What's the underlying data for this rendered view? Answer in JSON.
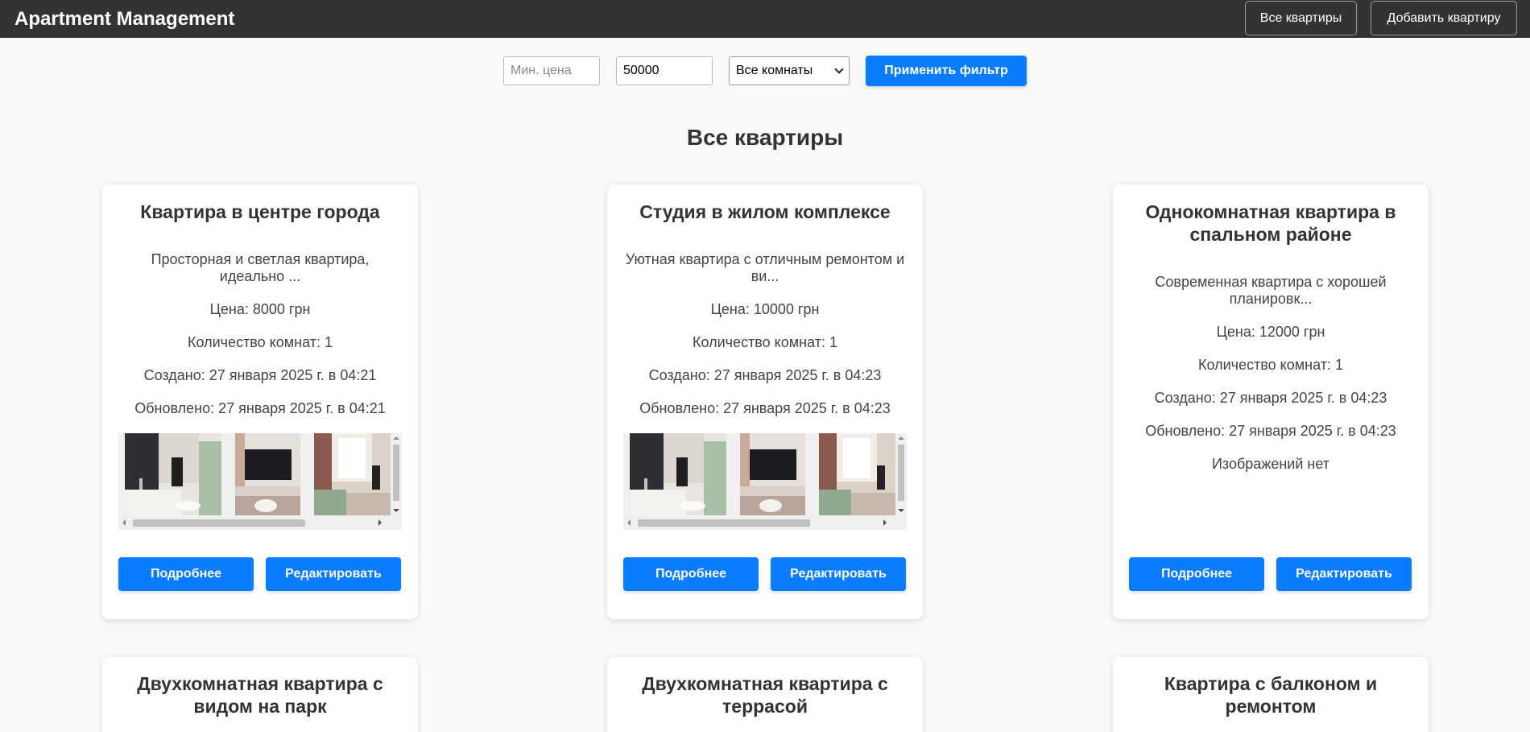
{
  "header": {
    "brand": "Apartment Management",
    "nav": {
      "all_label": "Все квартиры",
      "add_label": "Добавить квартиру"
    }
  },
  "filter": {
    "min_price_placeholder": "Мин. цена",
    "min_price_value": "",
    "max_price_value": "50000",
    "rooms_selected": "Все комнаты",
    "apply_label": "Применить фильтр"
  },
  "page_title": "Все квартиры",
  "cards": [
    {
      "title": "Квартира в центре города",
      "description": "Просторная и светлая квартира, идеально ...",
      "price": "Цена: 8000 грн",
      "rooms": "Количество комнат: 1",
      "created": "Создано: 27 января 2025 г. в 04:21",
      "updated": "Обновлено: 27 января 2025 г. в 04:21",
      "more_label": "Подробнее",
      "edit_label": "Редактировать"
    },
    {
      "title": "Студия в жилом комплексе",
      "description": "Уютная квартира с отличным ремонтом и ви...",
      "price": "Цена: 10000 грн",
      "rooms": "Количество комнат: 1",
      "created": "Создано: 27 января 2025 г. в 04:23",
      "updated": "Обновлено: 27 января 2025 г. в 04:23",
      "more_label": "Подробнее",
      "edit_label": "Редактировать"
    },
    {
      "title": "Однокомнатная квартира в спальном районе",
      "description": "Современная квартира с хорошей планировк...",
      "price": "Цена: 12000 грн",
      "rooms": "Количество комнат: 1",
      "created": "Создано: 27 января 2025 г. в 04:23",
      "updated": "Обновлено: 27 января 2025 г. в 04:23",
      "no_images": "Изображений нет",
      "more_label": "Подробнее",
      "edit_label": "Редактировать"
    },
    {
      "title": "Двухкомнатная квартира с видом на парк"
    },
    {
      "title": "Двухкомнатная квартира с террасой"
    },
    {
      "title": "Квартира с балконом и ремонтом"
    }
  ],
  "colors": {
    "primary": "#0a7cff",
    "header_bg": "#333333",
    "page_bg": "#f8f9fa"
  }
}
